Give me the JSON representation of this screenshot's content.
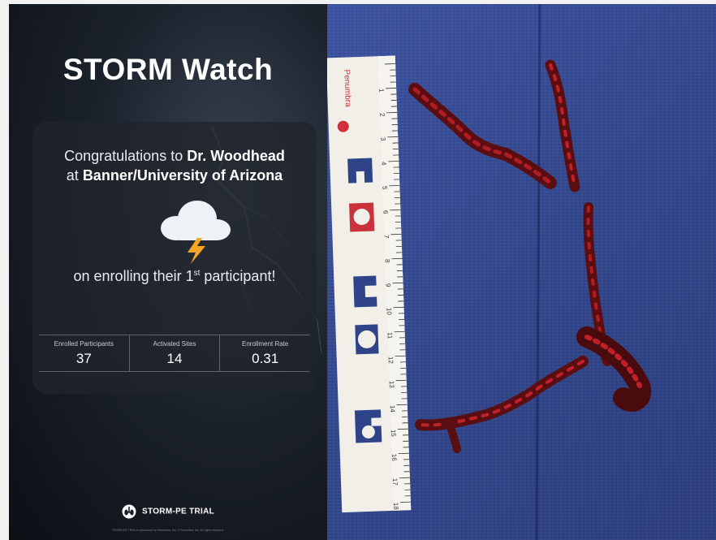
{
  "poster": {
    "title": "STORM Watch",
    "congrats_prefix": "Congratulations to ",
    "doctor": "Dr. Woodhead",
    "congrats_at": "at ",
    "site": "Banner/University of Arizona",
    "enroll_prefix": "on enrolling their 1",
    "enroll_sup": "st",
    "enroll_suffix": " participant!",
    "weather_icon": "storm-cloud-icon",
    "stats": [
      {
        "label": "Enrolled Participants",
        "value": "37"
      },
      {
        "label": "Activated Sites",
        "value": "14"
      },
      {
        "label": "Enrollment Rate",
        "value": "0.31"
      }
    ],
    "logo_text": "STORM-PE TRIAL",
    "fineprint": "STORM-PE TRIAL is sponsored by Penumbra, Inc. © Penumbra, Inc. All rights reserved."
  },
  "photo": {
    "ruler_brand": "Penumbra",
    "ruler_numbers": [
      "1",
      "2",
      "3",
      "4",
      "5",
      "6",
      "7",
      "8",
      "9",
      "10",
      "11",
      "12",
      "13",
      "14",
      "15",
      "16",
      "17",
      "18"
    ],
    "colors": {
      "drape": "#33488f",
      "clot": "#7a1418",
      "clot_highlight": "#c0202a"
    }
  }
}
